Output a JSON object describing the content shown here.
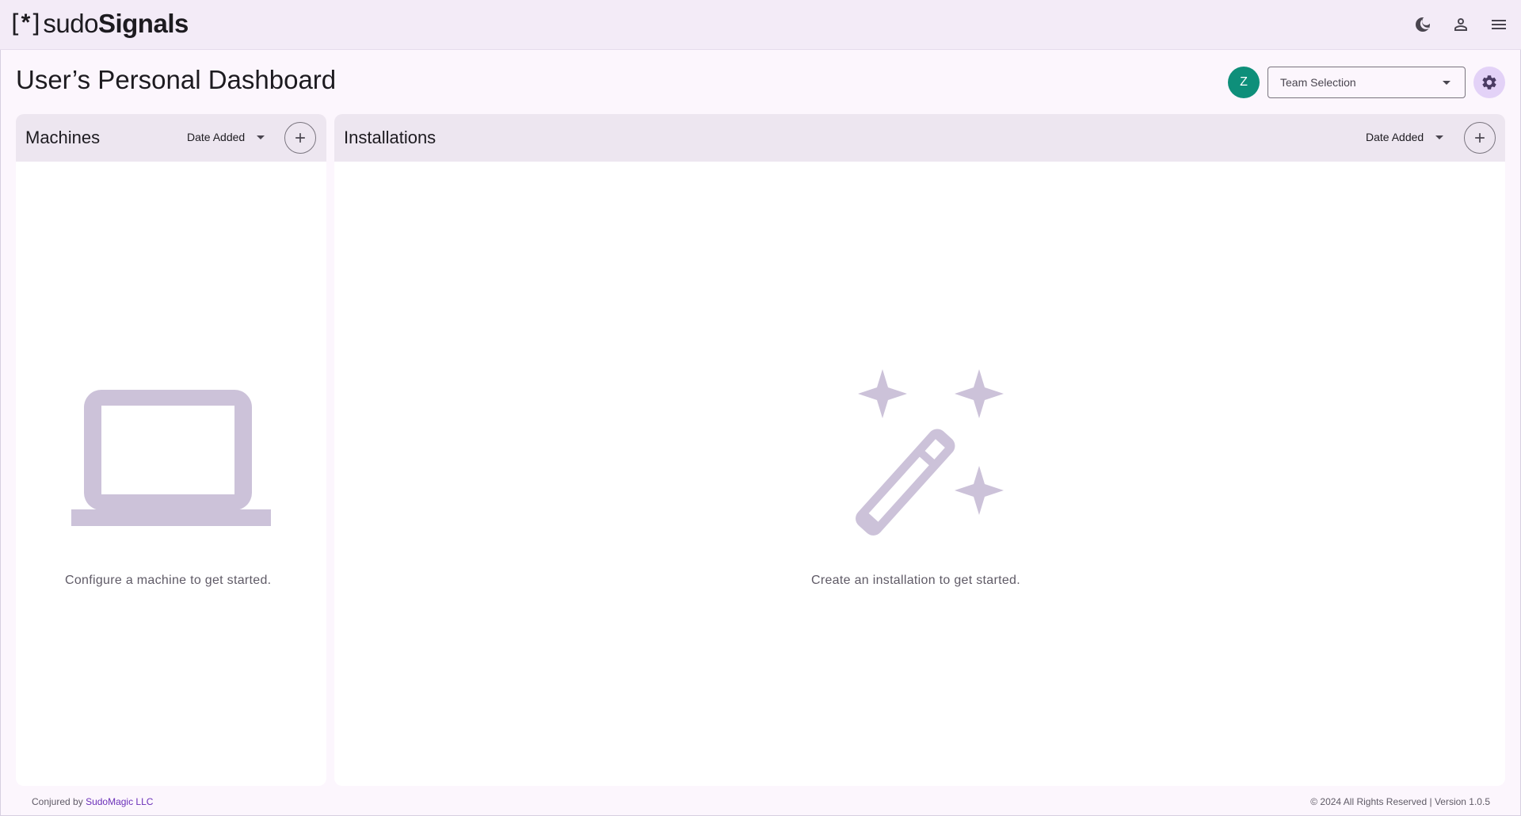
{
  "app": {
    "logo_bracket_open": "[",
    "logo_star": "*",
    "logo_bracket_close": "]",
    "logo_sudo": "sudo",
    "logo_signals": "Signals"
  },
  "topbar": {
    "icons": [
      "dark-mode-icon",
      "account-icon",
      "menu-icon"
    ]
  },
  "header": {
    "title": "User’s Personal Dashboard",
    "avatar_letter": "Z",
    "avatar_color": "#0e8f7a",
    "team_select_value": "Team Selection"
  },
  "machines": {
    "title": "Machines",
    "sort_label": "Date Added",
    "empty_message": "Configure a machine to get started."
  },
  "installations": {
    "title": "Installations",
    "sort_label": "Date Added",
    "empty_message": "Create an installation to get started."
  },
  "footer": {
    "credit_prefix": "Conjured by",
    "credit_link": "SudoMagic LLC",
    "copyright": "© 2024 All Rights Reserved | Version 1.0.5"
  },
  "colors": {
    "accent": "#6a2fb8",
    "topbar_bg": "#f3ebf7",
    "panel_header_bg": "#ede6f0",
    "illustration": "#ccc2d9"
  }
}
